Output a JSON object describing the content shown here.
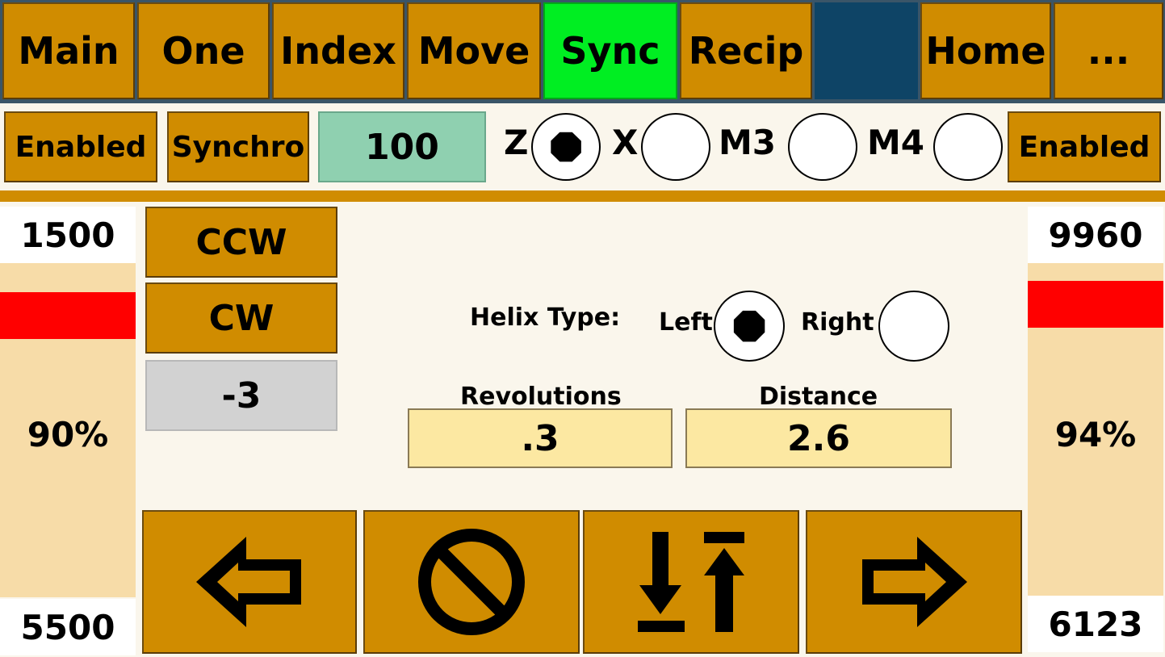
{
  "tabs": [
    {
      "label": "Main"
    },
    {
      "label": "One"
    },
    {
      "label": "Index"
    },
    {
      "label": "Move"
    },
    {
      "label": "Sync",
      "active": true
    },
    {
      "label": "Recip"
    },
    {
      "label": ""
    },
    {
      "label": "Home"
    },
    {
      "label": "..."
    }
  ],
  "row2": {
    "left_enable_label": "Enabled",
    "mode_label": "Synchro",
    "feed_value": "100",
    "axes": [
      {
        "label": "Z",
        "selected": true
      },
      {
        "label": "X",
        "selected": false
      },
      {
        "label": "M3",
        "selected": false
      },
      {
        "label": "M4",
        "selected": false
      }
    ],
    "right_enable_label": "Enabled"
  },
  "left_gauge": {
    "top_value": "1500",
    "percent_label": "90%",
    "bottom_value": "5500",
    "level": 0.9,
    "bar_color": "#ff0000"
  },
  "right_gauge": {
    "top_value": "9960",
    "percent_label": "94%",
    "bottom_value": "6123",
    "level": 0.94,
    "bar_color": "#ff0000"
  },
  "direction": {
    "ccw_label": "CCW",
    "cw_label": "CW",
    "step_value": "-3"
  },
  "helix": {
    "type_label": "Helix Type:",
    "left_label": "Left",
    "right_label": "Right",
    "selected": "left"
  },
  "revolutions": {
    "label": "Revolutions",
    "value": ".3"
  },
  "distance": {
    "label": "Distance",
    "value": "2.6"
  },
  "actions": [
    {
      "icon": "arrow-left-icon"
    },
    {
      "icon": "stop-icon"
    },
    {
      "icon": "sync-up-down-icon"
    },
    {
      "icon": "arrow-right-icon"
    }
  ],
  "colors": {
    "button": "#d08c00",
    "active_tab": "#00ee22",
    "blank_tab": "#0e4466",
    "feed_field": "#8fd0b0",
    "input_field": "#fce8a2",
    "gauge_bg": "#f7dca8"
  }
}
